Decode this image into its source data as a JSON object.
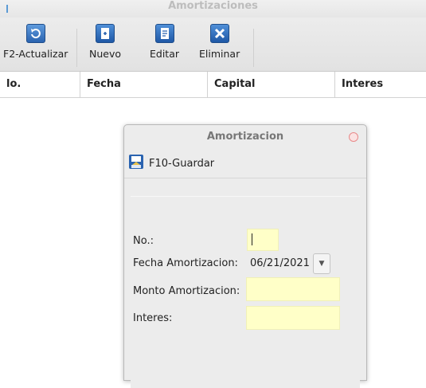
{
  "window": {
    "title": "Amortizaciones"
  },
  "toolbar": {
    "refresh_label": "F2-Actualizar",
    "new_label": "Nuevo",
    "edit_label": "Editar",
    "delete_label": "Eliminar"
  },
  "grid": {
    "columns": [
      "lo.",
      "Fecha",
      "Capital",
      "Interes"
    ]
  },
  "dialog": {
    "title": "Amortizacion",
    "save_label": "F10-Guardar",
    "fields": {
      "no_label": "No.:",
      "no_value": "",
      "date_label": "Fecha Amortizacion:",
      "date_value": "06/21/2021",
      "amount_label": "Monto Amortizacion:",
      "amount_value": "",
      "interest_label": "Interes:",
      "interest_value": ""
    }
  },
  "colors": {
    "field_background": "#ffffc8",
    "close_button": "#e88a8a"
  }
}
